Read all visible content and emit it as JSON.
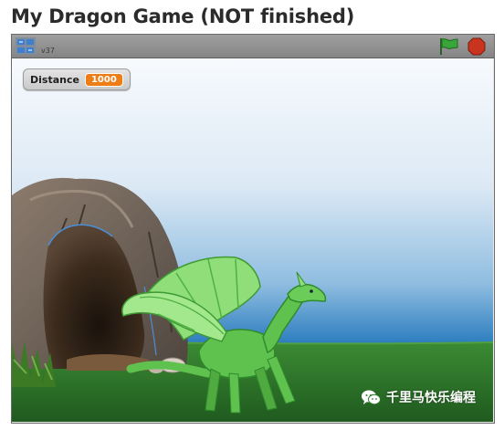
{
  "project": {
    "title": "My Dragon Game (NOT finished)"
  },
  "player": {
    "version": "v37",
    "green_flag_icon": "green-flag-icon",
    "stop_icon": "stop-sign-icon",
    "logo_icon": "scratch-logo-icon"
  },
  "stage": {
    "variable_monitor": {
      "name": "Distance",
      "value": "1000"
    },
    "sprites": [
      "cave",
      "dragon",
      "rocks",
      "grass"
    ]
  },
  "watermark": {
    "icon": "wechat-icon",
    "text": "千里马快乐编程"
  },
  "colors": {
    "sky_top": "#f4f8fc",
    "sky_bottom": "#2f7fc0",
    "grass": "#2f7a2c",
    "dragon": "#5fc24f",
    "dragon_wing": "#8fde7a",
    "monitor_value": "#ee7d16",
    "stop": "#c8341e",
    "flag": "#3aa53a"
  }
}
